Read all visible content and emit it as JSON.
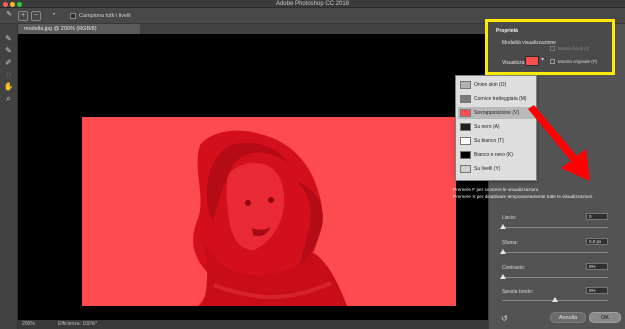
{
  "window": {
    "title": "Adobe Photoshop CC 2018",
    "controls": [
      "close-icon",
      "minimize-icon",
      "zoom-icon"
    ]
  },
  "toolbar": {
    "options_checkbox_label": "Campiona tutti i livelli"
  },
  "document": {
    "tab_title": "modella.jpg @ 200% (RGB/8)",
    "status_zoom": "200%",
    "status_efficiency": "Efficienza: 100%*"
  },
  "properties": {
    "tab_label": "Proprietà",
    "section_title": "Modalità visualizzazione",
    "view_label": "Visualizza:",
    "show_edges_label": "Mostra bordi (J)",
    "show_original_label": "Mostra originale (P)"
  },
  "view_modes": {
    "items": [
      {
        "label": "Onion skin (O)",
        "thumb_color": "#b3b3b3"
      },
      {
        "label": "Cornice tratteggiata (M)",
        "thumb_color": "#7a7a7a"
      },
      {
        "label": "Sovrapposizione (V)",
        "thumb_color": "#ff4f55",
        "selected": true
      },
      {
        "label": "Su nero (A)",
        "thumb_color": "#1f1f1f"
      },
      {
        "label": "Su bianco (T)",
        "thumb_color": "#ffffff"
      },
      {
        "label": "Bianco e nero (K)",
        "thumb_color": "#000000"
      },
      {
        "label": "Su livelli (Y)",
        "thumb_color": "#d0d0d0"
      }
    ]
  },
  "help_text": {
    "line1": "Premere F per scorrere le visualizzazioni.",
    "line2": "Premere X per disattivare temporaneamente tutte le visualizzazioni."
  },
  "adjustments": {
    "smooth": {
      "label": "Liscio:",
      "value": "0"
    },
    "feather": {
      "label": "Sfuma:",
      "value": "0,0 px"
    },
    "contrast": {
      "label": "Contrasto:",
      "value": "0%"
    },
    "shift_edge": {
      "label": "Sposta bordo:",
      "value": "0%"
    }
  },
  "buttons": {
    "cancel": "Annulla",
    "ok": "OK"
  },
  "colors": {
    "overlay": "#fe4b50",
    "highlight": "#ffeb00",
    "arrow": "#ff0000",
    "panel_bg": "#535353"
  }
}
